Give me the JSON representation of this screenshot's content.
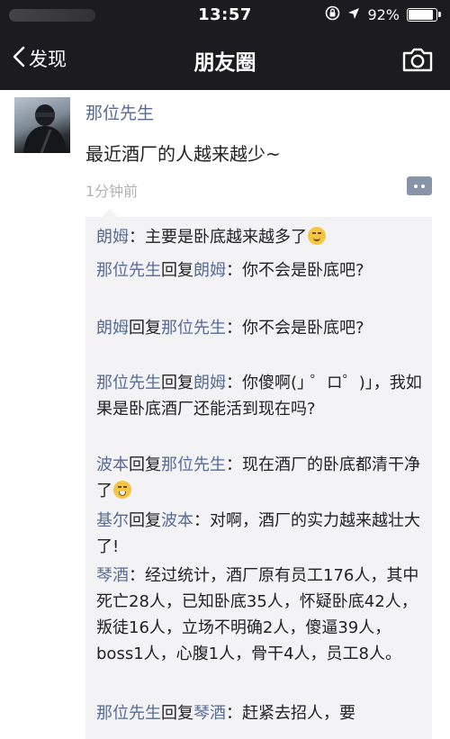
{
  "status_bar": {
    "time": "13:57",
    "battery_text": "92%",
    "battery_level": 0.92
  },
  "nav": {
    "back_label": "发现",
    "title": "朋友圈"
  },
  "post": {
    "author": "那位先生",
    "text": "最近酒厂的人越来越少~",
    "time": "1分钟前"
  },
  "comments": {
    "reply_word": "回复",
    "items": [
      {
        "author": "朗姆",
        "text": "：主要是卧底越来越多了"
      },
      {
        "author": "那位先生",
        "reply_to": "朗姆",
        "text": "：你不会是卧底吧?"
      },
      {
        "author": "朗姆",
        "reply_to": "那位先生",
        "text": "：你不会是卧底吧?"
      },
      {
        "author": "那位先生",
        "reply_to": "朗姆",
        "text": "：你傻啊(｣ ゜ロ゜)｣，我如果是卧底酒厂还能活到现在吗?"
      },
      {
        "author": "波本",
        "reply_to": "那位先生",
        "text": "：现在酒厂的卧底都清干净了"
      },
      {
        "author": "基尔",
        "reply_to": "波本",
        "text": "：对啊，酒厂的实力越来越壮大了!"
      },
      {
        "author": "琴酒",
        "text": "：经过统计，酒厂原有员工176人，其中死亡28人，已知卧底35人，怀疑卧底42人，叛徒16人，立场不明确2人，傻逼39人，boss1人，心腹1人，骨干4人，员工8人。"
      },
      {
        "author": "那位先生",
        "reply_to": "琴酒",
        "text": "：赶紧去招人，要"
      }
    ]
  }
}
